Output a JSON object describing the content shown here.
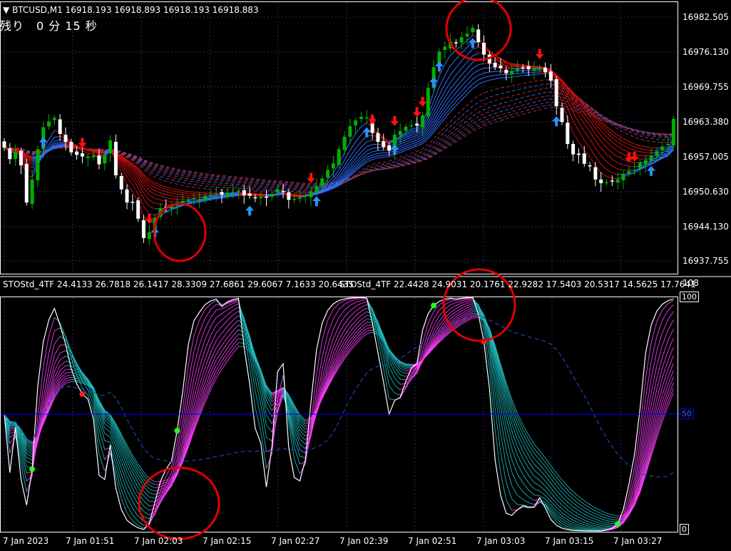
{
  "window": {
    "symbol_header": "BTCUSD,M1  16918.193 16918.893 16918.193 16918.883",
    "countdown": "残り　0 分 15 秒"
  },
  "colors": {
    "background": "#000000",
    "grid": "#2a2a6a",
    "bull_candle": "#00b000",
    "bear_candle": "#ffffff",
    "ribbon_red": "#d01010",
    "ribbon_blue": "#3070ff",
    "arrow_up": "#2f90ff",
    "arrow_down": "#ff1010",
    "circle": "#e00000",
    "sto_magenta": "#ff40ff",
    "sto_teal": "#20c0c0",
    "level_line": "#0000ff"
  },
  "price_axis": {
    "labels": [
      "16982.505",
      "16976.130",
      "16969.755",
      "16963.380",
      "16957.005",
      "16950.630",
      "16944.130",
      "16937.755"
    ]
  },
  "indicator": {
    "header_left": "STOStd_4TF 24.4133 26.7818 26.1417 28.3309 27.6861 29.6067 7.1633 20.6435",
    "header_right": "STOStd_4TF 22.4428 24.9031 20.1761 22.9282 17.5403 20.5317 14.5625 17.7641",
    "scale_top": "108",
    "level_100": "100",
    "level_50": "50",
    "level_0": "0"
  },
  "time_axis": {
    "labels": [
      "7 Jan 2023",
      "7 Jan 01:51",
      "7 Jan 02:03",
      "7 Jan 02:15",
      "7 Jan 02:27",
      "7 Jan 02:39",
      "7 Jan 02:51",
      "7 Jan 03:03",
      "7 Jan 03:15",
      "7 Jan 03:27"
    ]
  },
  "price_series": {
    "closes": [
      16958.6,
      16956.4,
      16957.8,
      16955.2,
      16948.1,
      16952.5,
      16958.3,
      16962.5,
      16963.6,
      16964.3,
      16961.2,
      16959.7,
      16957.7,
      16957.2,
      16956.9,
      16956.9,
      16957.1,
      16955.4,
      16957.2,
      16960.0,
      16953.3,
      16950.6,
      16948.1,
      16948.2,
      16945.0,
      16941.3,
      16942.4,
      16945.2,
      16947.0,
      16947.2,
      16947.6,
      16948.0,
      16948.4,
      16948.6,
      16948.9,
      16948.7,
      16949.3,
      16949.5,
      16949.8,
      16949.6,
      16950.0,
      16950.1,
      16950.3,
      16949.5,
      16949.4,
      16949.1,
      16949.2,
      16949.0,
      16949.7,
      16950.6,
      16950.2,
      16948.6,
      16948.8,
      16949.0,
      16949.4,
      16950.2,
      16951.2,
      16952.7,
      16954.3,
      16955.6,
      16958.3,
      16960.7,
      16962.7,
      16963.8,
      16964.5,
      16964.4,
      16961.4,
      16959.7,
      16958.7,
      16958.0,
      16961.1,
      16961.8,
      16962.6,
      16962.9,
      16962.8,
      16964.8,
      16970.0,
      16974.0,
      16977.0,
      16977.9,
      16978.9,
      16978.7,
      16979.7,
      16980.4,
      16981.5,
      16978.8,
      16976.4,
      16974.7,
      16974.0,
      16973.8,
      16972.8,
      16973.3,
      16973.8,
      16973.9,
      16973.6,
      16973.7,
      16973.9,
      16973.0,
      16971.4,
      16966.5,
      16963.5,
      16959.3,
      16957.3,
      16957.2,
      16955.5,
      16955.0,
      16952.5,
      16951.8,
      16952.0,
      16952.2,
      16952.5,
      16953.6,
      16954.1,
      16954.3,
      16955.7,
      16956.2,
      16957.0,
      16957.9,
      16958.8,
      16959.3,
      16964.1
    ]
  },
  "signals": {
    "up_arrows": [
      7,
      27,
      44,
      56,
      65,
      70,
      77,
      78,
      84,
      99,
      116,
      125
    ],
    "down_arrows": [
      14,
      26,
      55,
      66,
      70,
      74,
      75,
      96,
      112,
      113
    ]
  }
}
